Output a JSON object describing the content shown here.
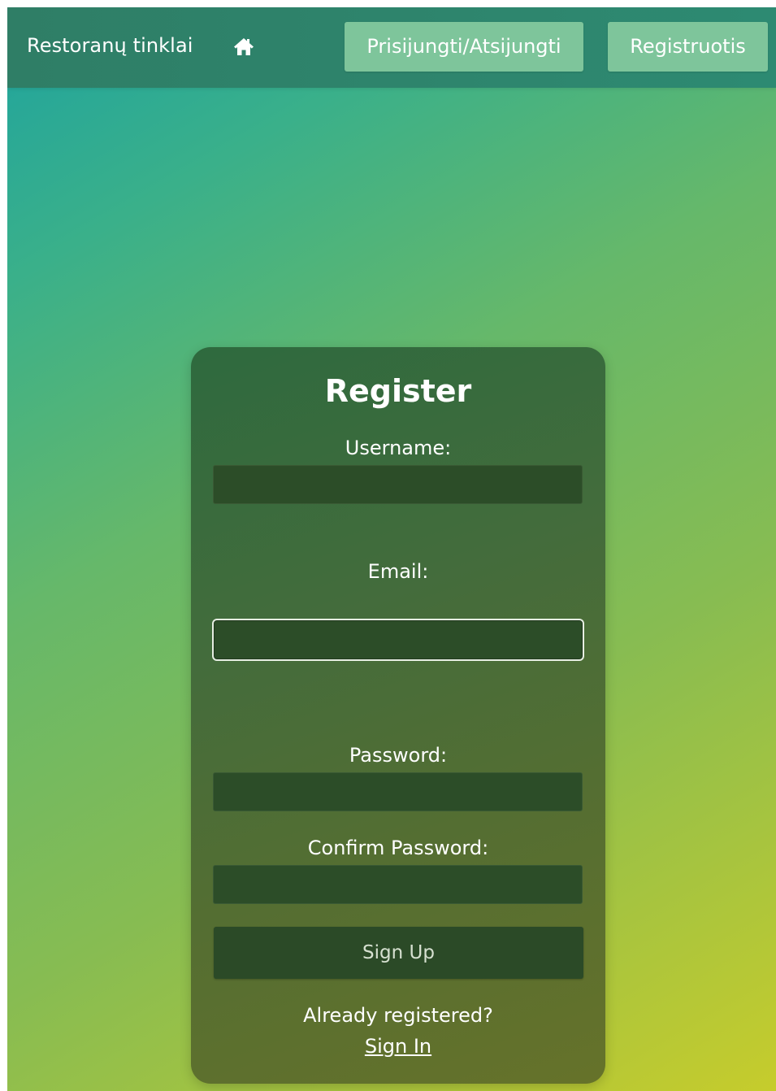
{
  "navbar": {
    "brand": "Restoranų tinklai",
    "home_icon": "home-icon",
    "login_label": "Prisijungti/Atsijungti",
    "register_label": "Registruotis"
  },
  "form": {
    "title": "Register",
    "username_label": "Username:",
    "username_value": "",
    "email_label": "Email:",
    "email_value": "",
    "password_label": "Password:",
    "password_value": "",
    "confirm_label": "Confirm Password:",
    "confirm_value": "",
    "submit_label": "Sign Up",
    "already_text": "Already registered?",
    "signin_link": "Sign In"
  },
  "colors": {
    "navbar": "#2e846c",
    "nav_button": "#7ec59b",
    "card": "#436c3c",
    "input": "#2c4d28",
    "gradient_start": "#1ea39f",
    "gradient_end": "#c6cc2c"
  }
}
